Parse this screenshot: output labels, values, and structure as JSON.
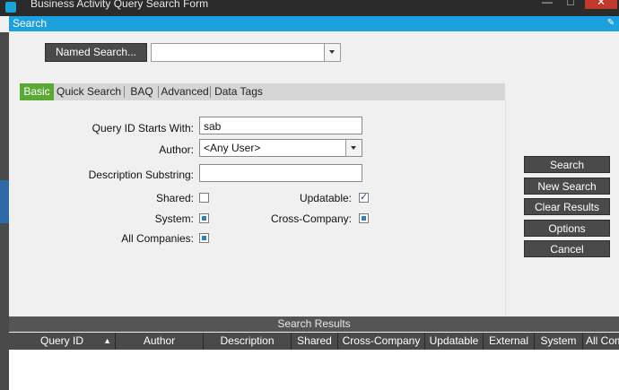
{
  "window": {
    "title": "Business Activity Query Search Form",
    "buttons": {
      "minimize": "—",
      "maximize": "□",
      "close": "✕"
    }
  },
  "dialog": {
    "title": "Search"
  },
  "named_search": {
    "button_label": "Named Search...",
    "value": ""
  },
  "tabs": [
    {
      "label": "Basic",
      "active": true
    },
    {
      "label": "Quick Search",
      "active": false
    },
    {
      "label": "BAQ",
      "active": false
    },
    {
      "label": "Advanced",
      "active": false
    },
    {
      "label": "Data Tags",
      "active": false
    }
  ],
  "form": {
    "query_id": {
      "label": "Query ID Starts With:",
      "value": "sab"
    },
    "author": {
      "label": "Author:",
      "value": "<Any User>"
    },
    "description": {
      "label": "Description Substring:",
      "value": ""
    },
    "shared": {
      "label": "Shared:",
      "checked": false
    },
    "updatable": {
      "label": "Updatable:",
      "checked": true
    },
    "system": {
      "label": "System:",
      "state": "indeterminate"
    },
    "cross_company": {
      "label": "Cross-Company:",
      "state": "indeterminate"
    },
    "all_companies": {
      "label": "All Companies:",
      "state": "indeterminate"
    }
  },
  "actions": {
    "search": "Search",
    "new_search": "New Search",
    "clear_results": "Clear Results",
    "options": "Options",
    "cancel": "Cancel"
  },
  "results": {
    "title": "Search Results",
    "columns": [
      "Query ID",
      "Author",
      "Description",
      "Shared",
      "Cross-Company",
      "Updatable",
      "External",
      "System",
      "All Com"
    ],
    "rows": []
  },
  "colors": {
    "accent": "#1ba1dd",
    "active_tab": "#5aa934",
    "button_dark": "#4a4a4a"
  }
}
